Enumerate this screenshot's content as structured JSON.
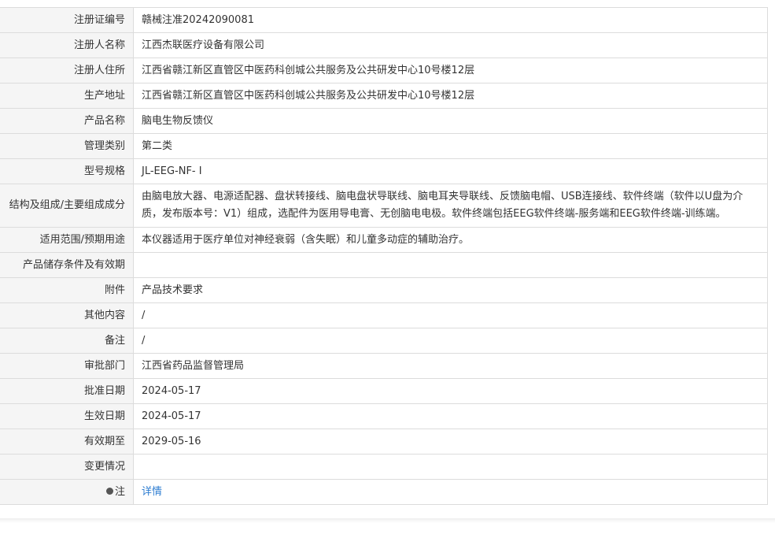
{
  "rows": [
    {
      "label": "注册证编号",
      "value": "赣械注准20242090081"
    },
    {
      "label": "注册人名称",
      "value": "江西杰联医疗设备有限公司"
    },
    {
      "label": "注册人住所",
      "value": "江西省赣江新区直管区中医药科创城公共服务及公共研发中心10号楼12层"
    },
    {
      "label": "生产地址",
      "value": "江西省赣江新区直管区中医药科创城公共服务及公共研发中心10号楼12层"
    },
    {
      "label": "产品名称",
      "value": "脑电生物反馈仪"
    },
    {
      "label": "管理类别",
      "value": "第二类"
    },
    {
      "label": "型号规格",
      "value": "JL-EEG-NF- I"
    },
    {
      "label": "结构及组成/主要组成成分",
      "value": "由脑电放大器、电源适配器、盘状转接线、脑电盘状导联线、脑电耳夹导联线、反馈脑电帽、USB连接线、软件终端（软件以U盘为介质，发布版本号：V1）组成，选配件为医用导电膏、无创脑电电极。软件终端包括EEG软件终端-服务端和EEG软件终端-训练端。"
    },
    {
      "label": "适用范围/预期用途",
      "value": "本仪器适用于医疗单位对神经衰弱（含失眠）和儿童多动症的辅助治疗。"
    },
    {
      "label": "产品储存条件及有效期",
      "value": ""
    },
    {
      "label": "附件",
      "value": "产品技术要求"
    },
    {
      "label": "其他内容",
      "value": "/"
    },
    {
      "label": "备注",
      "value": "/"
    },
    {
      "label": "审批部门",
      "value": "江西省药品监督管理局"
    },
    {
      "label": "批准日期",
      "value": "2024-05-17"
    },
    {
      "label": "生效日期",
      "value": "2024-05-17"
    },
    {
      "label": "有效期至",
      "value": "2029-05-16"
    },
    {
      "label": "变更情况",
      "value": ""
    },
    {
      "label": "注",
      "value": "详情"
    }
  ]
}
